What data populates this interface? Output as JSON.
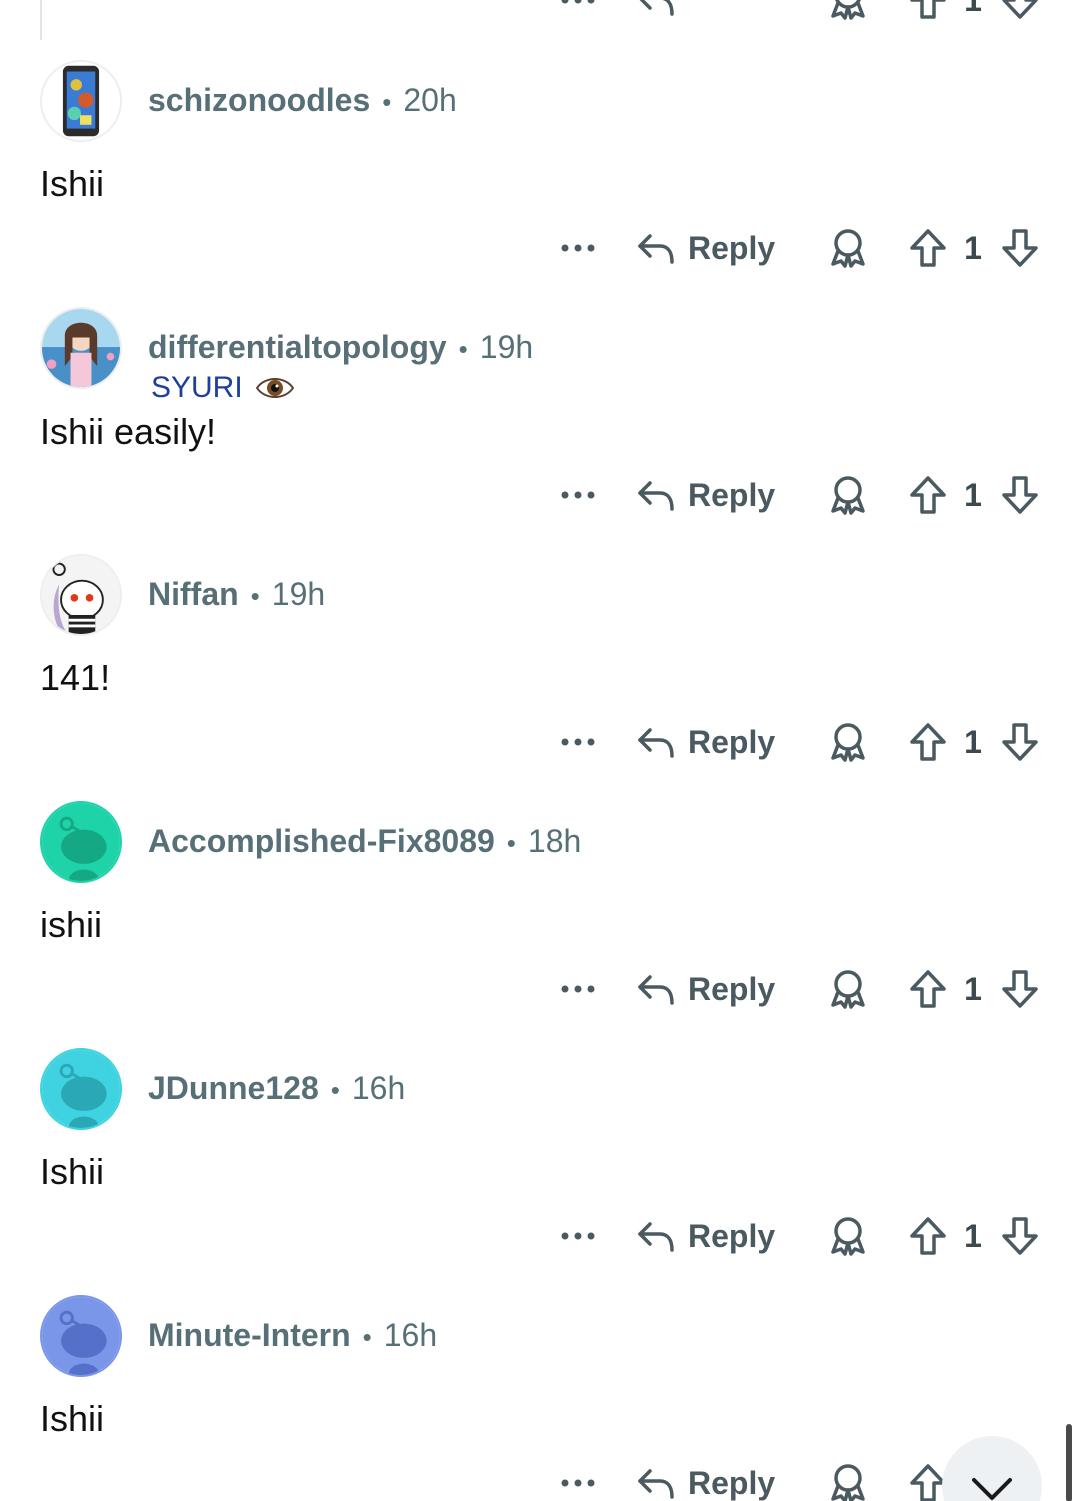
{
  "actions": {
    "more_icon": "ellipsis-icon",
    "reply_label": "Reply",
    "award_icon": "award-icon",
    "upvote_icon": "upvote-arrow-icon",
    "downvote_icon": "downvote-arrow-icon"
  },
  "top_partial": {
    "score": "1"
  },
  "comments": [
    {
      "username": "schizonoodles",
      "separator": "•",
      "time": "20h",
      "flair": "",
      "text": "Ishii",
      "score": "1"
    },
    {
      "username": "differentialtopology",
      "separator": "•",
      "time": "19h",
      "flair": "SYURI",
      "text": "Ishii easily!",
      "score": "1"
    },
    {
      "username": "Niffan",
      "separator": "•",
      "time": "19h",
      "flair": "",
      "text": "141!",
      "score": "1"
    },
    {
      "username": "Accomplished-Fix8089",
      "separator": "•",
      "time": "18h",
      "flair": "",
      "text": "ishii",
      "score": "1"
    },
    {
      "username": "JDunne128",
      "separator": "•",
      "time": "16h",
      "flair": "",
      "text": "Ishii",
      "score": "1"
    },
    {
      "username": "Minute-Intern",
      "separator": "•",
      "time": "16h",
      "flair": "",
      "text": "Ishii",
      "score": ""
    }
  ],
  "fab": {
    "icon": "chevron-down-icon"
  },
  "colors": {
    "meta": "#576f76",
    "flair": "#1f3f9c",
    "icons": "#4a5a60"
  }
}
